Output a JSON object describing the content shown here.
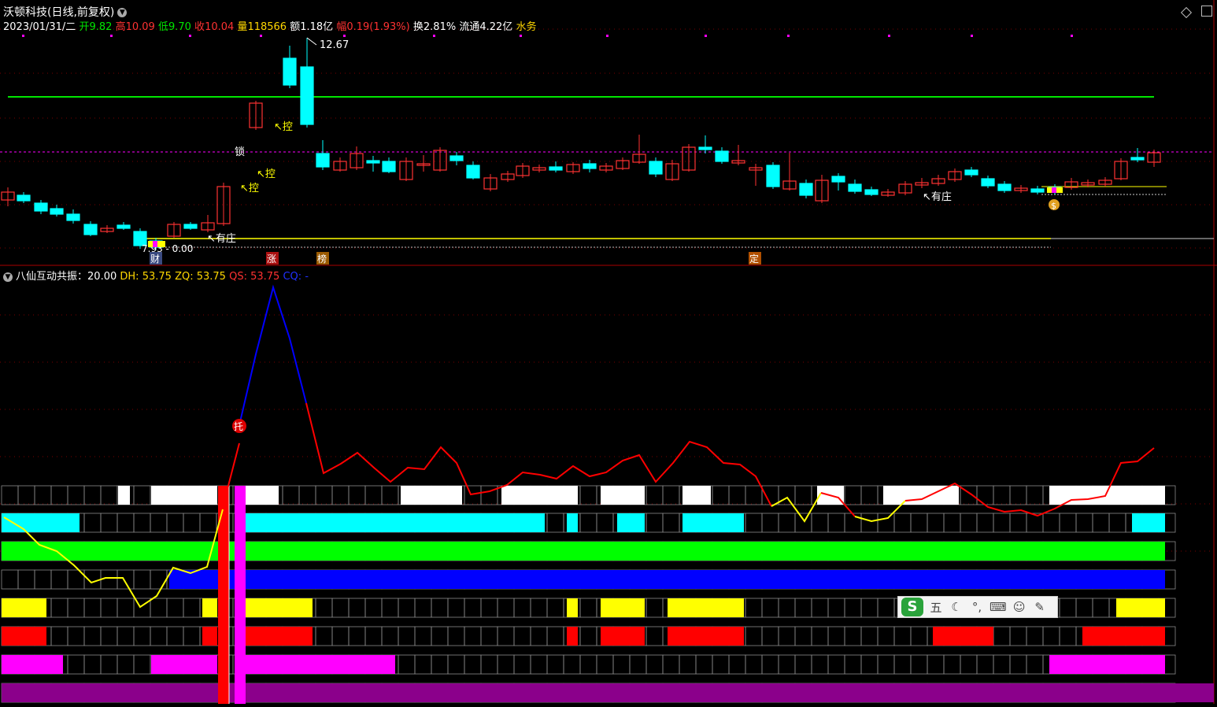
{
  "title": {
    "stock_name": "沃顿科技",
    "period_mode": "(日线,前复权)",
    "dropdown_icon": "chevron-down-icon"
  },
  "quote": {
    "date": "2023/01/31/二",
    "open_label": "开",
    "open_value": "9.82",
    "high_label": "高",
    "high_value": "10.09",
    "low_label": "低",
    "low_value": "9.70",
    "close_label": "收",
    "close_value": "10.04",
    "volume_label": "量",
    "volume_value": "118566",
    "amount_label": "额",
    "amount_value": "1.18亿",
    "change_label": "幅",
    "change_value": "0.19(1.93%)",
    "turnover_label": "换",
    "turnover_value": "2.81%",
    "float_label": "流通",
    "float_value": "4.22亿",
    "industry": "水务"
  },
  "window_buttons": [
    "restore-icon",
    "maximize-icon"
  ],
  "annotations": {
    "peak_price": "12.67",
    "low_price": "7.93 - 0.00",
    "kong1": "↖控",
    "kong2": "↖控",
    "kong3": "↖控",
    "suo": "锁",
    "youzhuang1": "↖有庄",
    "youzhuang2": "↖有庄",
    "cai": "财",
    "zhang": "涨",
    "bang": "榜",
    "ding": "定",
    "tuo": "托",
    "money": "$"
  },
  "indicator": {
    "name": "八仙互动共振",
    "value": "20.00",
    "dh_label": "DH:",
    "dh_value": "53.75",
    "zq_label": "ZQ:",
    "zq_value": "53.75",
    "qs_label": "QS:",
    "qs_value": "53.75",
    "cq_label": "CQ:",
    "cq_value": "-"
  },
  "colors": {
    "up": "#ff3232",
    "down": "#00ffff",
    "green_line": "#00e600",
    "yellow": "#ffff00",
    "blue": "#0000ff",
    "magenta": "#ff00ff",
    "purple": "#8b008b",
    "red_band": "#ff0000",
    "white_band": "#ffffff",
    "cyan_band": "#00ffff",
    "green_band": "#00ff00"
  },
  "ime": {
    "logo": "S",
    "mode": "五",
    "items": [
      "moon-icon",
      "punct-icon",
      "keyboard-icon",
      "user-icon",
      "wrench-icon"
    ]
  }
}
